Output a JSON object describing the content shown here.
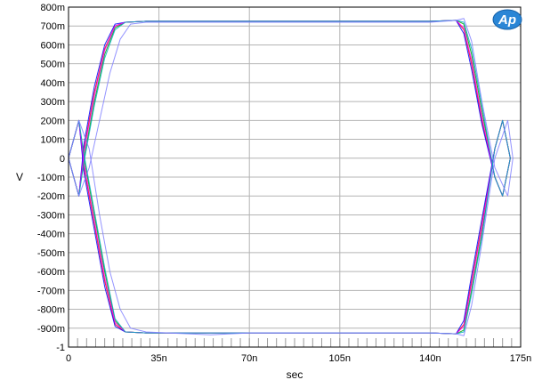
{
  "chart_data": {
    "type": "line",
    "title": "",
    "xlabel": "sec",
    "ylabel": "V",
    "xlim": [
      0,
      1.75e-07
    ],
    "ylim": [
      -1,
      0.8
    ],
    "grid": true,
    "legend": "none",
    "logo_text": "Ap",
    "x_ticks": [
      {
        "value": 0,
        "label": "0"
      },
      {
        "value": 3.5e-08,
        "label": "35n"
      },
      {
        "value": 7e-08,
        "label": "70n"
      },
      {
        "value": 1.05e-07,
        "label": "105n"
      },
      {
        "value": 1.4e-07,
        "label": "140n"
      },
      {
        "value": 1.75e-07,
        "label": "175n"
      }
    ],
    "y_ticks": [
      {
        "value": 0.8,
        "label": "800m"
      },
      {
        "value": 0.7,
        "label": "700m"
      },
      {
        "value": 0.6,
        "label": "600m"
      },
      {
        "value": 0.5,
        "label": "500m"
      },
      {
        "value": 0.4,
        "label": "400m"
      },
      {
        "value": 0.3,
        "label": "300m"
      },
      {
        "value": 0.2,
        "label": "200m"
      },
      {
        "value": 0.1,
        "label": "100m"
      },
      {
        "value": 0,
        "label": "0"
      },
      {
        "value": -0.1,
        "label": "-100m"
      },
      {
        "value": -0.2,
        "label": "-200m"
      },
      {
        "value": -0.3,
        "label": "-300m"
      },
      {
        "value": -0.4,
        "label": "-400m"
      },
      {
        "value": -0.5,
        "label": "-500m"
      },
      {
        "value": -0.6,
        "label": "-600m"
      },
      {
        "value": -0.7,
        "label": "-700m"
      },
      {
        "value": -0.8,
        "label": "-800m"
      },
      {
        "value": -0.9,
        "label": "-900m"
      },
      {
        "value": -1,
        "label": "-1"
      }
    ],
    "series": [
      {
        "color": "#e8000b",
        "x": [
          0,
          2e-09,
          4e-09,
          6e-09,
          1e-08,
          1.4e-08,
          1.8e-08,
          2.2e-08,
          3e-08,
          7e-08,
          1.4e-07,
          1.5e-07,
          1.53e-07,
          1.56e-07,
          1.6e-07,
          1.65e-07,
          1.68e-07,
          1.71e-07
        ],
        "y": [
          0,
          -0.1,
          -0.2,
          0.05,
          0.35,
          0.58,
          0.7,
          0.72,
          0.725,
          0.725,
          0.725,
          0.73,
          0.68,
          0.5,
          0.2,
          -0.1,
          -0.2,
          0
        ]
      },
      {
        "color": "#e8000b",
        "x": [
          0,
          2e-09,
          4e-09,
          6e-09,
          1e-08,
          1.4e-08,
          1.8e-08,
          2.2e-08,
          3e-08,
          7e-08,
          1.4e-07,
          1.5e-07,
          1.53e-07,
          1.56e-07,
          1.6e-07,
          1.65e-07,
          1.68e-07,
          1.71e-07
        ],
        "y": [
          0,
          0.1,
          0.2,
          -0.05,
          -0.35,
          -0.65,
          -0.88,
          -0.92,
          -0.925,
          -0.925,
          -0.925,
          -0.93,
          -0.88,
          -0.65,
          -0.35,
          0.05,
          0.2,
          0
        ]
      },
      {
        "color": "#0000ff",
        "x": [
          0,
          2e-09,
          4e-09,
          6e-09,
          1e-08,
          1.4e-08,
          1.8e-08,
          2.2e-08,
          3e-08,
          7e-08,
          1.4e-07,
          1.5e-07,
          1.53e-07,
          1.56e-07,
          1.6e-07,
          1.65e-07,
          1.68e-07,
          1.71e-07
        ],
        "y": [
          0,
          -0.1,
          -0.2,
          0.08,
          0.38,
          0.6,
          0.71,
          0.72,
          0.725,
          0.725,
          0.725,
          0.73,
          0.66,
          0.47,
          0.18,
          -0.1,
          -0.2,
          0
        ]
      },
      {
        "color": "#0000ff",
        "x": [
          0,
          2e-09,
          4e-09,
          6e-09,
          1e-08,
          1.4e-08,
          1.8e-08,
          2.2e-08,
          3e-08,
          7e-08,
          1.4e-07,
          1.5e-07,
          1.53e-07,
          1.56e-07,
          1.6e-07,
          1.65e-07,
          1.68e-07,
          1.71e-07
        ],
        "y": [
          0,
          0.1,
          0.2,
          -0.08,
          -0.38,
          -0.68,
          -0.89,
          -0.92,
          -0.925,
          -0.925,
          -0.925,
          -0.93,
          -0.86,
          -0.62,
          -0.32,
          0.05,
          0.2,
          0
        ]
      },
      {
        "color": "#00a000",
        "x": [
          0,
          2e-09,
          4e-09,
          6e-09,
          1e-08,
          1.4e-08,
          1.8e-08,
          2.2e-08,
          3e-08,
          7e-08,
          1.4e-07,
          1.5e-07,
          1.53e-07,
          1.56e-07,
          1.6e-07,
          1.65e-07,
          1.68e-07,
          1.71e-07
        ],
        "y": [
          0,
          -0.1,
          -0.2,
          0.0,
          0.3,
          0.55,
          0.69,
          0.72,
          0.725,
          0.725,
          0.725,
          0.73,
          0.71,
          0.55,
          0.25,
          -0.1,
          -0.2,
          0
        ]
      },
      {
        "color": "#00a000",
        "x": [
          0,
          2e-09,
          4e-09,
          6e-09,
          1e-08,
          1.4e-08,
          1.8e-08,
          2.2e-08,
          3e-08,
          7e-08,
          1.4e-07,
          1.5e-07,
          1.53e-07,
          1.56e-07,
          1.6e-07,
          1.65e-07,
          1.68e-07,
          1.71e-07
        ],
        "y": [
          0,
          0.1,
          0.2,
          0.0,
          -0.3,
          -0.6,
          -0.86,
          -0.92,
          -0.925,
          -0.925,
          -0.925,
          -0.93,
          -0.91,
          -0.7,
          -0.4,
          0.05,
          0.2,
          0
        ]
      },
      {
        "color": "#ff00ff",
        "x": [
          0,
          2e-09,
          4e-09,
          6e-09,
          1e-08,
          1.4e-08,
          1.8e-08,
          2.2e-08,
          3e-08,
          7e-08,
          1.4e-07,
          1.5e-07,
          1.53e-07,
          1.56e-07,
          1.6e-07,
          1.65e-07,
          1.68e-07,
          1.71e-07
        ],
        "y": [
          0,
          -0.1,
          -0.2,
          0.03,
          0.33,
          0.57,
          0.7,
          0.72,
          0.725,
          0.725,
          0.725,
          0.73,
          0.69,
          0.52,
          0.22,
          -0.1,
          -0.2,
          0
        ]
      },
      {
        "color": "#ff00ff",
        "x": [
          0,
          2e-09,
          4e-09,
          6e-09,
          1e-08,
          1.4e-08,
          1.8e-08,
          2.2e-08,
          3e-08,
          7e-08,
          1.4e-07,
          1.5e-07,
          1.53e-07,
          1.56e-07,
          1.6e-07,
          1.65e-07,
          1.68e-07,
          1.71e-07
        ],
        "y": [
          0,
          0.1,
          0.2,
          -0.03,
          -0.33,
          -0.63,
          -0.87,
          -0.92,
          -0.925,
          -0.925,
          -0.925,
          -0.93,
          -0.89,
          -0.67,
          -0.37,
          0.05,
          0.2,
          0
        ]
      },
      {
        "color": "#00b0c0",
        "x": [
          0,
          2e-09,
          4e-09,
          6e-09,
          1e-08,
          1.4e-08,
          1.8e-08,
          2.2e-08,
          3e-08,
          7e-08,
          1.4e-07,
          1.5e-07,
          1.53e-07,
          1.56e-07,
          1.6e-07,
          1.65e-07,
          1.68e-07,
          1.71e-07
        ],
        "y": [
          0,
          -0.1,
          -0.2,
          -0.02,
          0.28,
          0.53,
          0.68,
          0.72,
          0.725,
          0.725,
          0.725,
          0.73,
          0.72,
          0.58,
          0.28,
          -0.1,
          -0.2,
          0
        ]
      },
      {
        "color": "#00b0c0",
        "x": [
          0,
          2e-09,
          4e-09,
          6e-09,
          1e-08,
          1.4e-08,
          1.8e-08,
          2.2e-08,
          3e-08,
          7e-08,
          1.4e-07,
          1.5e-07,
          1.53e-07,
          1.56e-07,
          1.6e-07,
          1.65e-07,
          1.68e-07,
          1.71e-07
        ],
        "y": [
          0,
          0.1,
          0.2,
          0.02,
          -0.28,
          -0.58,
          -0.85,
          -0.92,
          -0.925,
          -0.925,
          -0.925,
          -0.93,
          -0.92,
          -0.72,
          -0.42,
          0.05,
          0.2,
          0
        ]
      },
      {
        "color": "#8080ff",
        "x": [
          0,
          4e-09,
          8e-09,
          1.2e-08,
          1.6e-08,
          2e-08,
          2.4e-08,
          3e-08,
          7e-08,
          1.4e-07,
          1.5e-07,
          1.53e-07,
          1.56e-07,
          1.6e-07,
          1.65e-07,
          1.7e-07,
          1.72e-07
        ],
        "y": [
          0,
          -0.2,
          -0.05,
          0.2,
          0.45,
          0.63,
          0.71,
          0.72,
          0.72,
          0.72,
          0.73,
          0.74,
          0.62,
          0.3,
          -0.05,
          -0.2,
          0
        ]
      },
      {
        "color": "#8080ff",
        "x": [
          0,
          4e-09,
          8e-09,
          1.2e-08,
          1.6e-08,
          2e-08,
          2.4e-08,
          3e-08,
          5.5e-08,
          7e-08,
          1.4e-07,
          1.5e-07,
          1.53e-07,
          1.56e-07,
          1.6e-07,
          1.65e-07,
          1.7e-07,
          1.72e-07
        ],
        "y": [
          0,
          0.2,
          0.05,
          -0.3,
          -0.6,
          -0.8,
          -0.9,
          -0.92,
          -0.935,
          -0.925,
          -0.925,
          -0.93,
          -0.94,
          -0.78,
          -0.45,
          0.0,
          0.2,
          0
        ]
      }
    ]
  }
}
